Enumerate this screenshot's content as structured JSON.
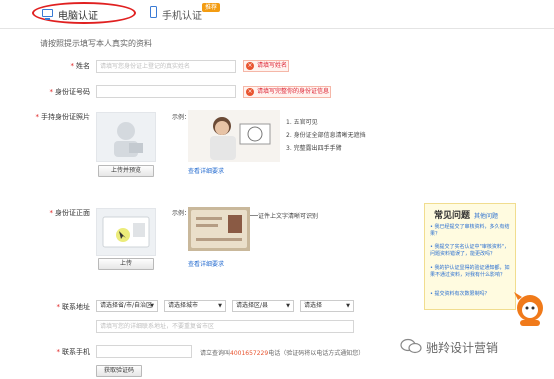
{
  "tabs": {
    "pc_label": "电脑认证",
    "mobile_label": "手机认证",
    "mobile_badge": "推荐"
  },
  "hint": "请按照提示填写本人真实的资料",
  "fields": {
    "name_label": "姓名",
    "name_placeholder": "请填写您身份证上登记的真实姓名",
    "name_error": "请填写姓名",
    "idno_label": "身份证号码",
    "idno_error": "请填写完整你的身份证信息",
    "hold_photo_label": "手持身份证照片",
    "id_front_label": "身份证正面",
    "address_label": "联系地址",
    "address_placeholder": "请填写您的详细联系地址，不要重复省市区",
    "mobile_label": "联系手机",
    "mobile_note_prefix": "请立查询叫",
    "mobile_note_phone": "4001657229",
    "mobile_note_suffix": "电话（验证码将以电话方式通知您）"
  },
  "hold_photo": {
    "example_label": "示例：",
    "upload_button": "上传并预览",
    "detail_link": "查看详细要求",
    "tips": [
      "1. 五官可见",
      "2. 身份证全部信息清晰无遮挡",
      "3. 完整露出四手手臂"
    ]
  },
  "id_front": {
    "example_label": "示例：",
    "upload_button": "上传",
    "detail_link": "查看详细要求",
    "tip": "证件上文字清晰可识别"
  },
  "address_selects": [
    "请选择省/市/自治区",
    "请选择城市",
    "请选择区/县",
    "请选择"
  ],
  "get_code_button": "获取验证码",
  "faq": {
    "title": "常见问题",
    "subtitle": "其他问题",
    "items": [
      "我已经提交了审核资料，多久有结果？",
      "我提交了实名认证中\"审核资料\"，问题资料错误了，能更改吗？",
      "我的护认证显得的验证通知都，如果不通过资料，对我有什么影响？",
      "提交资料有次数限制吗？"
    ]
  },
  "watermark": "驰羚设计营销",
  "colors": {
    "accent": "#2a6fd1",
    "error": "#e02020",
    "badge": "#f39c12",
    "faq_bg": "#fffbe0"
  }
}
